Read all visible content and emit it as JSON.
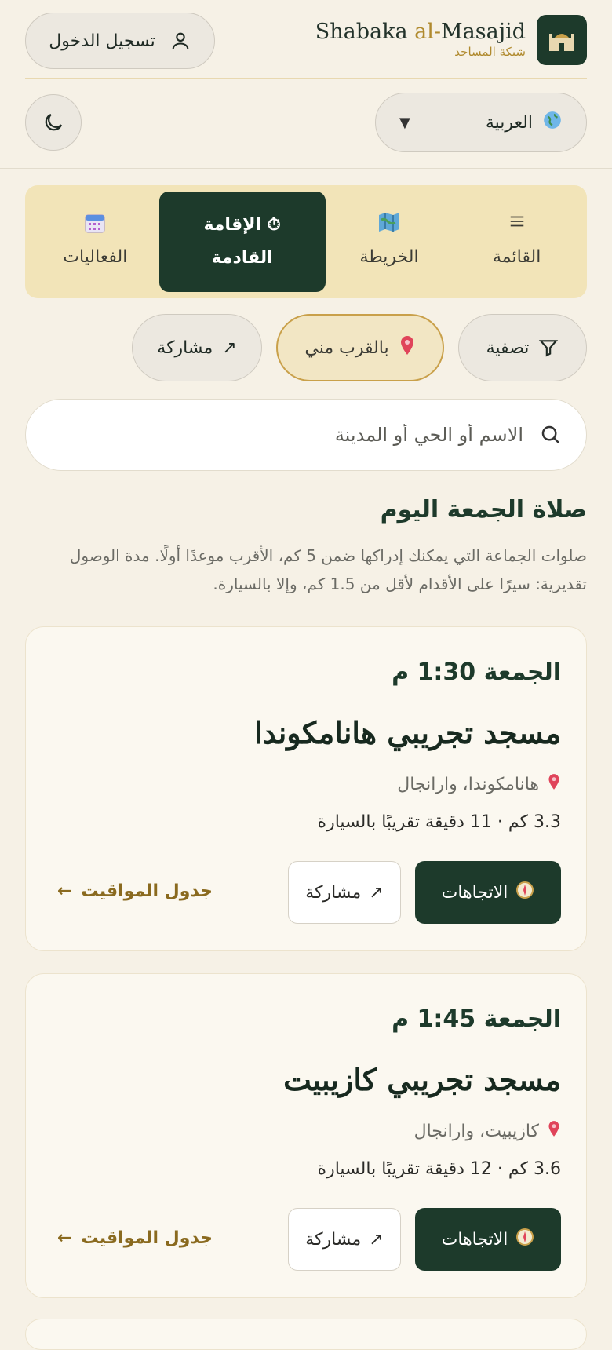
{
  "header": {
    "login_label": "تسجيل الدخول",
    "brand_name_pre": "Shabaka ",
    "brand_name_al": "al-",
    "brand_name_post": "Masajid",
    "brand_sub": "شبكة المساجد"
  },
  "language": {
    "selected": "العربية"
  },
  "tabs": [
    {
      "label": "القائمة",
      "icon": "list-icon"
    },
    {
      "label": "الخريطة",
      "icon": "map-icon"
    },
    {
      "label_line1": "⏱ الإقامة",
      "label_line2": "القادمة",
      "icon": "stopwatch-icon",
      "active": true
    },
    {
      "label": "الفعاليات",
      "icon": "calendar-icon"
    }
  ],
  "filters": {
    "filter_label": "تصفية",
    "near_label": "بالقرب مني",
    "share_label": "مشاركة"
  },
  "search": {
    "placeholder": "الاسم أو الحي أو المدينة"
  },
  "section": {
    "title": "صلاة الجمعة اليوم",
    "description": "صلوات الجماعة التي يمكنك إدراكها ضمن 5 كم، الأقرب موعدًا أولًا. مدة الوصول تقديرية: سيرًا على الأقدام لأقل من 1.5 كم، وإلا بالسيارة."
  },
  "cards": [
    {
      "time": "الجمعة 1:30 م",
      "name": "مسجد تجريبي هانامكوندا",
      "location": "هانامكوندا، وارانجال",
      "distance": "3.3 كم · 11 دقيقة تقريبًا بالسيارة",
      "directions_label": "الاتجاهات",
      "share_label": "مشاركة",
      "schedule_label": "جدول المواقيت"
    },
    {
      "time": "الجمعة 1:45 م",
      "name": "مسجد تجريبي كازيبيت",
      "location": "كازيبيت، وارانجال",
      "distance": "3.6 كم · 12 دقيقة تقريبًا بالسيارة",
      "directions_label": "الاتجاهات",
      "share_label": "مشاركة",
      "schedule_label": "جدول المواقيت"
    }
  ],
  "colors": {
    "primary": "#1d3a2b",
    "accent": "#b08a2e",
    "background": "#f6f1e6"
  }
}
